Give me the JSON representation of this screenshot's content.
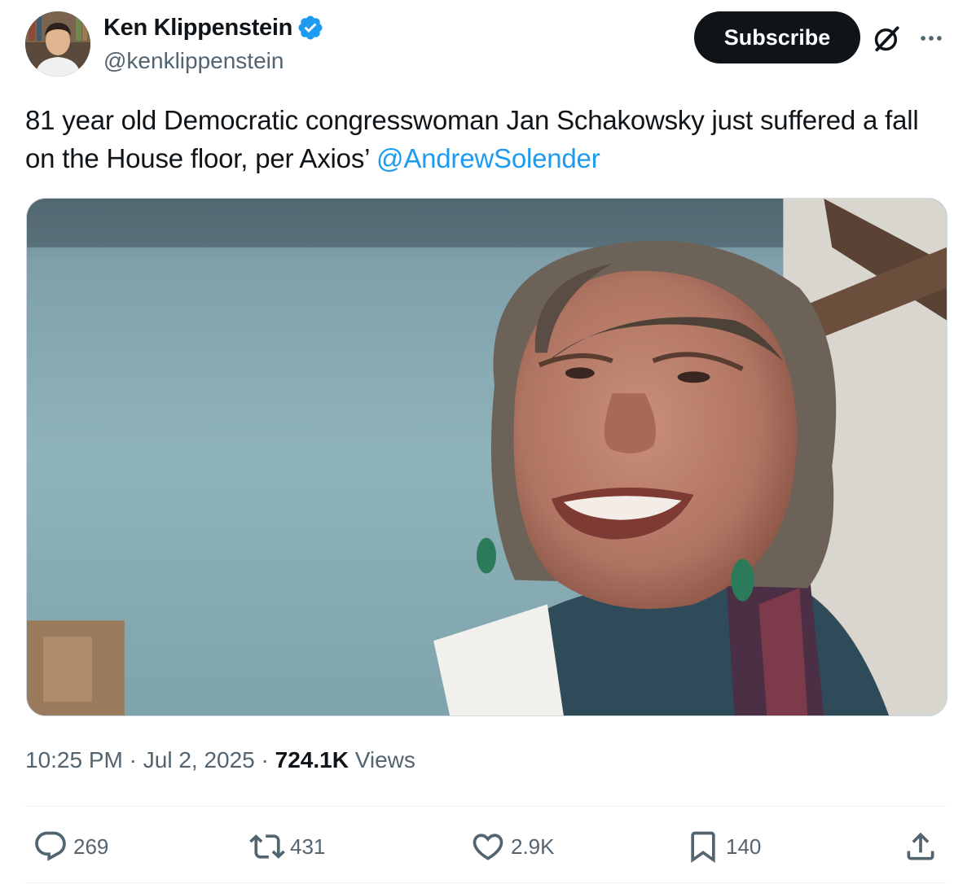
{
  "author": {
    "display_name": "Ken Klippenstein",
    "handle": "@kenklippenstein",
    "verified": true
  },
  "header": {
    "subscribe_label": "Subscribe",
    "icons": [
      "verified-badge-icon",
      "grok-icon",
      "more-icon"
    ]
  },
  "tweet": {
    "text": "81 year old Democratic congresswoman Jan Schakowsky just suffered a fall on the House floor, per Axios’ ",
    "mention": "@AndrewSolender"
  },
  "meta": {
    "time": "10:25 PM",
    "separator": " · ",
    "date": "Jul 2, 2025",
    "views_count": "724.1K",
    "views_label": " Views"
  },
  "actions": {
    "replies": "269",
    "retweets": "431",
    "likes": "2.9K",
    "bookmarks": "140"
  },
  "colors": {
    "text": "#0f1419",
    "secondary": "#536471",
    "accent": "#1d9bf0",
    "button_bg": "#0f1419"
  }
}
